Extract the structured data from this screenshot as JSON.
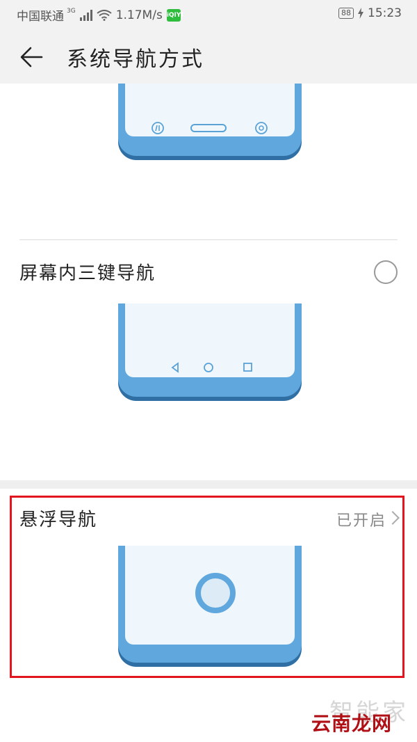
{
  "status_bar": {
    "carrier": "中国联通",
    "network_type": "3G",
    "speed": "1.17M/s",
    "app_icon_label": "iQIYI",
    "battery": "88",
    "time": "15:23"
  },
  "header": {
    "title": "系统导航方式"
  },
  "options": [
    {
      "label": "屏幕内三键导航",
      "selected": false
    },
    {
      "label": "悬浮导航",
      "status": "已开启"
    }
  ],
  "watermark": {
    "top": "智能家",
    "brand": "云南龙网"
  },
  "colors": {
    "phone_body": "#5fa7dc",
    "phone_screen": "#eff7fd",
    "highlight": "#e2141d"
  }
}
